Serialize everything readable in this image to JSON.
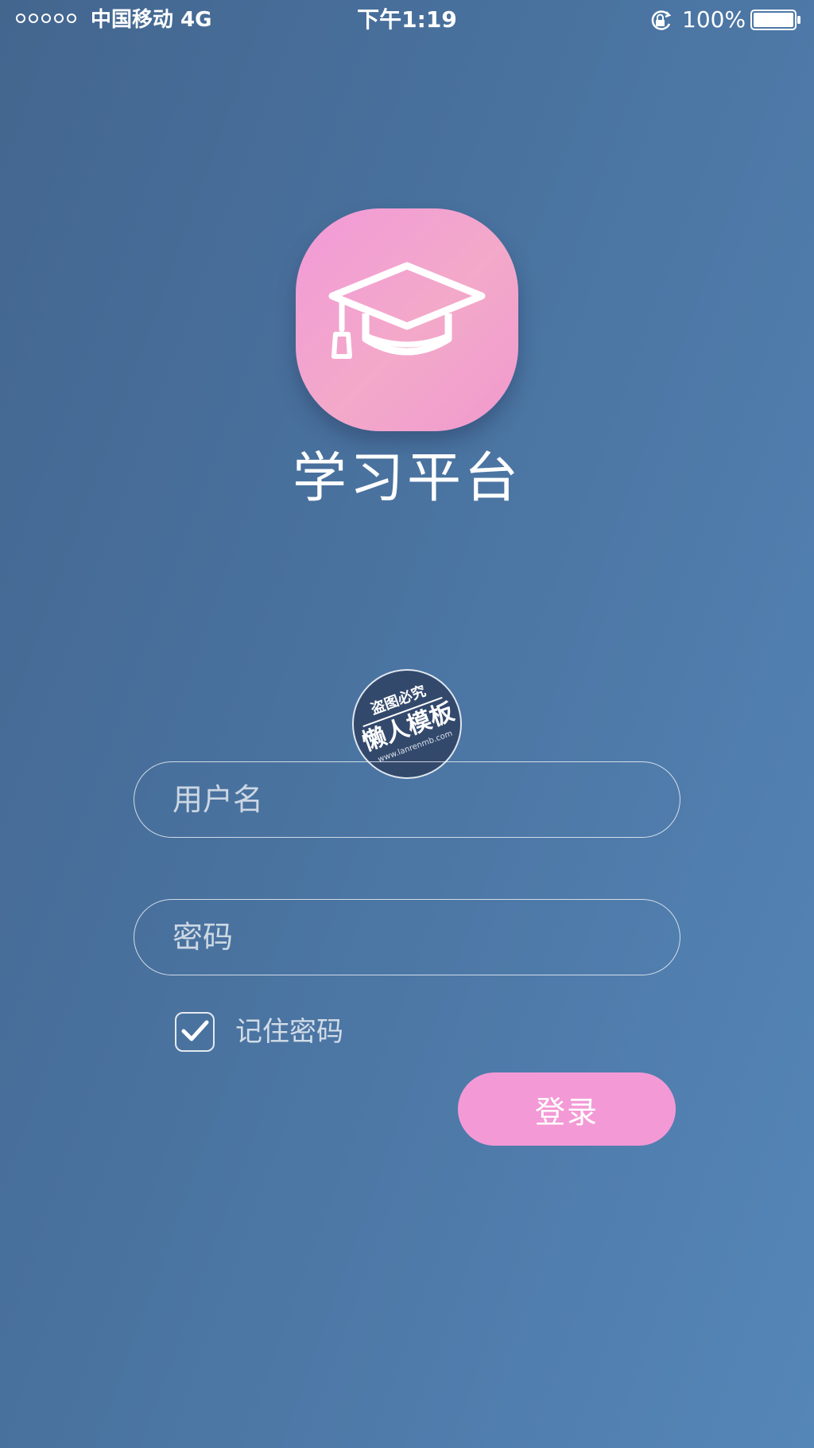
{
  "status_bar": {
    "carrier": "中国移动 4G",
    "time": "下午1:19",
    "battery": "100%",
    "icons": [
      "signal-dots",
      "orientation-lock-icon",
      "battery-icon"
    ]
  },
  "app": {
    "title": "学习平台",
    "logo_icon": "graduation-cap-icon"
  },
  "watermark": {
    "top_text": "盗图必究",
    "main_text": "懒人模板",
    "url": "www.lanrenmb.com"
  },
  "form": {
    "username_placeholder": "用户名",
    "password_placeholder": "密码",
    "remember_label": "记住密码",
    "remember_checked": true,
    "login_label": "登录"
  },
  "colors": {
    "background_start": "#43668f",
    "background_end": "#5586b8",
    "accent_pink": "#f39ad6",
    "text": "#ffffff"
  }
}
